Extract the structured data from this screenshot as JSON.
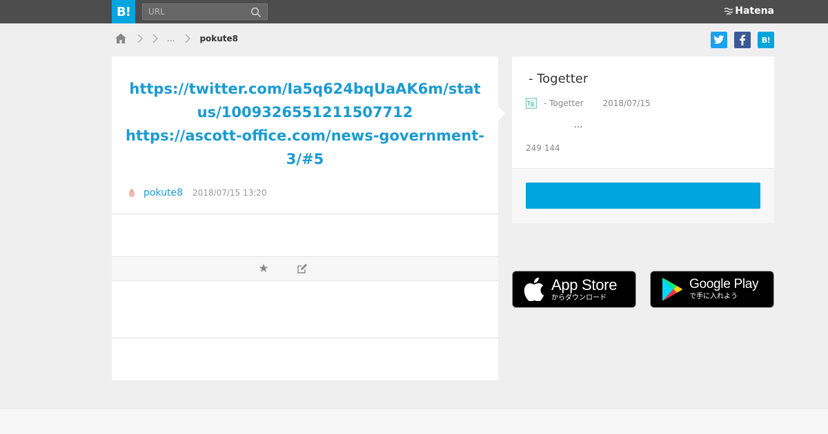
{
  "header": {
    "logo_text": "B!",
    "search_placeholder": "URL",
    "brand": "Hatena"
  },
  "breadcrumb": {
    "ellipsis": "...",
    "current": "pokute8"
  },
  "share": {
    "twitter": "t",
    "facebook": "f",
    "hatena": "B!"
  },
  "entry": {
    "title_line1": "https://twitter.com/Ia5q624bqUaAK6m/status/1009326551211507712",
    "title_line2": "https://ascott-office.com/news-government-3/#5",
    "user": "pokute8",
    "timestamp": "2018/07/15 13:20"
  },
  "sidebar": {
    "title": " - Togetter",
    "site": "- Togetter",
    "date": "2018/07/15",
    "desc": "...",
    "stats": "249 144"
  },
  "badges": {
    "appstore_big": "App Store",
    "appstore_small": "からダウンロード",
    "googleplay_big": "Google Play",
    "googleplay_small": "で手に入れよう"
  }
}
